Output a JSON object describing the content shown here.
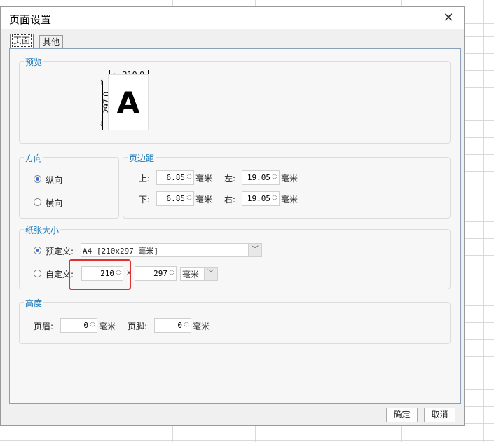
{
  "dialog": {
    "title": "页面设置"
  },
  "tabs": [
    {
      "label": "页面"
    },
    {
      "label": "其他"
    }
  ],
  "preview": {
    "title": "预览",
    "width": "210.0",
    "height": "297.0",
    "letter": "A"
  },
  "orientation": {
    "title": "方向",
    "portrait": "纵向",
    "landscape": "横向",
    "selected": "portrait"
  },
  "margins": {
    "title": "页边距",
    "top_label": "上:",
    "top_value": "6.85",
    "left_label": "左:",
    "left_value": "19.05",
    "bottom_label": "下:",
    "bottom_value": "6.85",
    "right_label": "右:",
    "right_value": "19.05",
    "unit": "毫米"
  },
  "paper": {
    "title": "纸张大小",
    "predefined_label": "预定义:",
    "predefined_value": "A4 [210x297 毫米]",
    "custom_label": "自定义:",
    "custom_width": "210",
    "separator": "x",
    "custom_height": "297",
    "unit": "毫米"
  },
  "height_group": {
    "title": "高度",
    "header_label": "页眉:",
    "header_value": "0",
    "footer_label": "页脚:",
    "footer_value": "0",
    "unit": "毫米"
  },
  "buttons": {
    "ok": "确定",
    "cancel": "取消"
  },
  "icons": {
    "close": "close-icon",
    "up": "spin-up-icon",
    "down": "spin-down-icon",
    "dropdown": "chevron-down-icon"
  },
  "colors": {
    "group_title": "#1e7ab8",
    "highlight": "#e03030",
    "radio_on": "#3a6fd8"
  }
}
